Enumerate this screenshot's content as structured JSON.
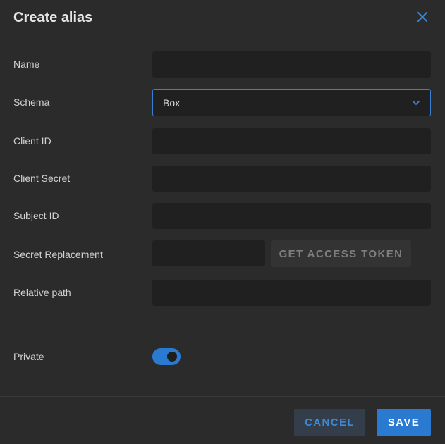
{
  "dialog": {
    "title": "Create alias"
  },
  "form": {
    "name_label": "Name",
    "name_value": "",
    "schema_label": "Schema",
    "schema_value": "Box",
    "client_id_label": "Client ID",
    "client_id_value": "",
    "client_secret_label": "Client Secret",
    "client_secret_value": "",
    "subject_id_label": "Subject ID",
    "subject_id_value": "",
    "secret_replacement_label": "Secret Replacement",
    "secret_replacement_value": "",
    "get_access_token_label": "GET ACCESS TOKEN",
    "relative_path_label": "Relative path",
    "relative_path_value": "",
    "private_label": "Private",
    "private_enabled": true
  },
  "footer": {
    "cancel_label": "CANCEL",
    "save_label": "SAVE"
  },
  "icons": {
    "close": "close-icon",
    "schema_dropdown": "chevron-down-icon"
  },
  "colors": {
    "accent": "#2a7ad2",
    "background": "#2b2b2b",
    "field_background": "#202020"
  }
}
